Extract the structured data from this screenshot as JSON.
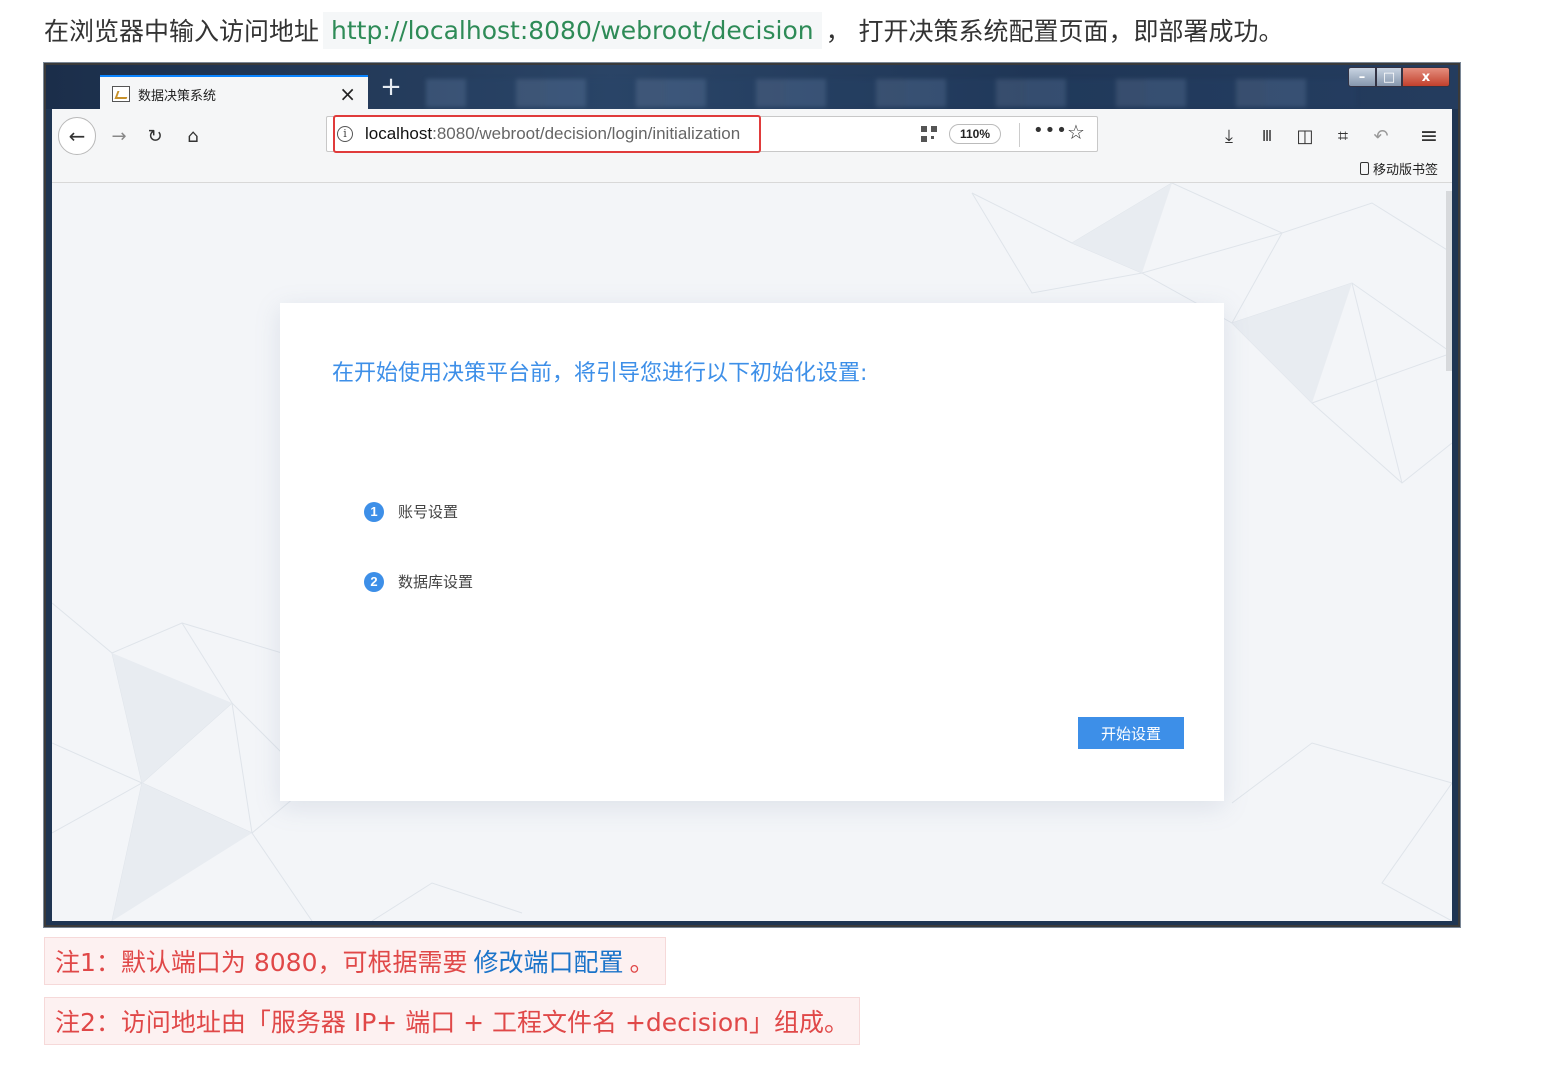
{
  "intro": {
    "before": "在浏览器中输入访问地址",
    "url": "http://localhost:8080/webroot/decision",
    "after": "， 打开决策系统配置页面，即部署成功。"
  },
  "browser": {
    "tab_title": "数据决策系统",
    "tab_close": "×",
    "new_tab": "+",
    "window_controls": {
      "minimize": "–",
      "maximize": "□",
      "close": "x"
    },
    "nav": {
      "back": "←",
      "forward": "→",
      "reload": "↻",
      "home": "⌂"
    },
    "url_bar": {
      "info": "i",
      "host": "localhost",
      "rest": ":8080/webroot/decision/login/initialization",
      "zoom": "110%",
      "more": "•••",
      "star": "☆"
    },
    "toolbar_icons": {
      "download": "⤓",
      "library": "Ⅲ",
      "sidebar": "◫",
      "screenshot": "⌗",
      "undo": "↶",
      "menu": "≡"
    },
    "mobile_bookmarks": "移动版书签"
  },
  "page": {
    "heading": "在开始使用决策平台前，将引导您进行以下初始化设置:",
    "steps": [
      {
        "num": "1",
        "label": "账号设置"
      },
      {
        "num": "2",
        "label": "数据库设置"
      }
    ],
    "start_button": "开始设置"
  },
  "notes": {
    "note1_before": "注1：默认端口为 8080，可根据需要",
    "note1_link": "修改端口配置",
    "note1_after": "。",
    "note2": "注2：访问地址由「服务器 IP+ 端口 + 工程文件名 +decision」组成。"
  },
  "colors": {
    "accent": "#3d8fe8",
    "note_red": "#e04848",
    "link": "#1a73c9",
    "code_green": "#2e8b57"
  }
}
